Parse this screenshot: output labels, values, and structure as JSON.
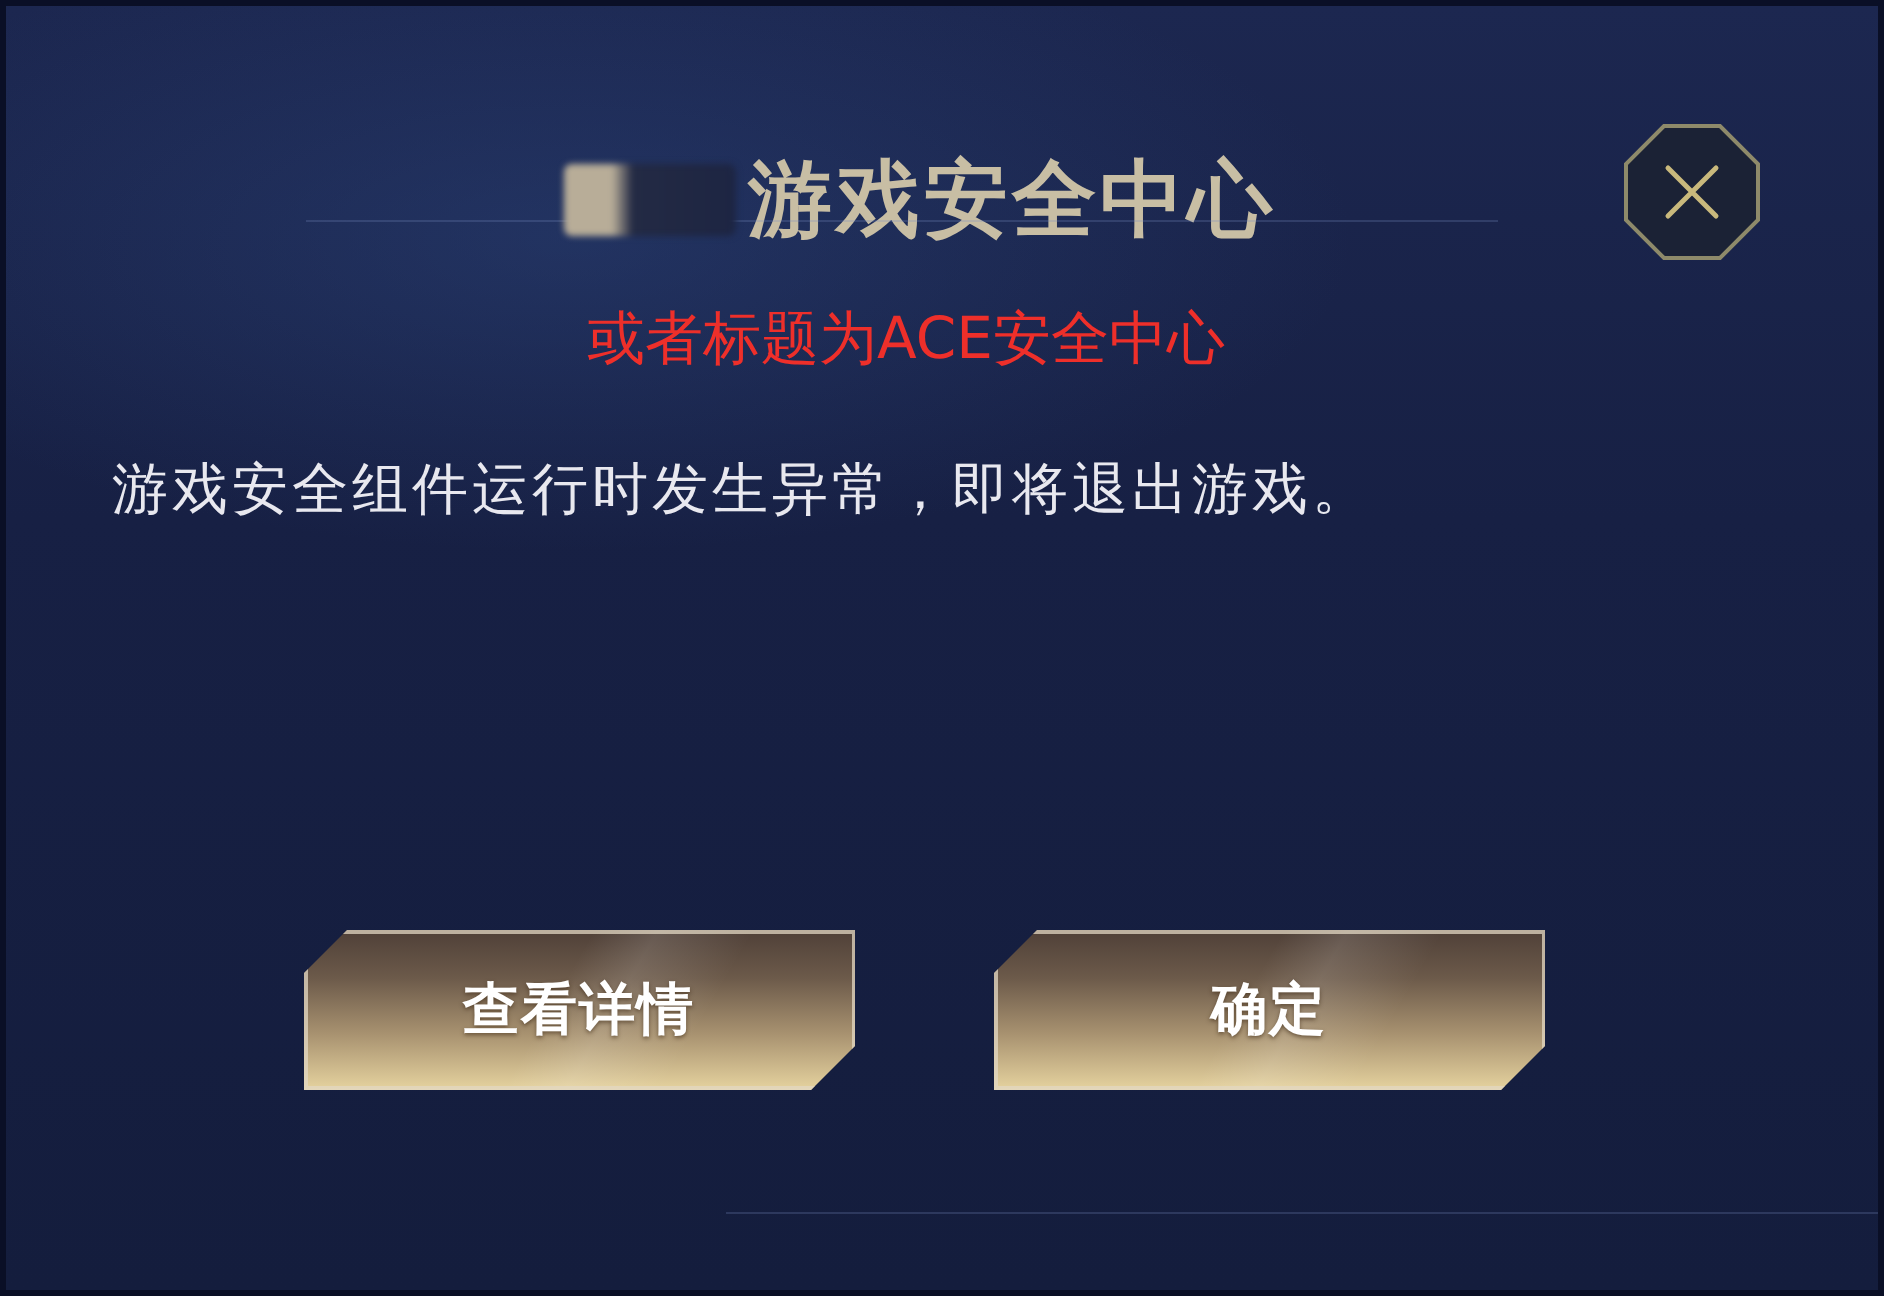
{
  "dialog": {
    "title": "游戏安全中心",
    "annotation": "或者标题为ACE安全中心",
    "message": "游戏安全组件运行时发生异常，即将退出游戏。",
    "buttons": [
      {
        "label": "查看详情"
      },
      {
        "label": "确定"
      }
    ]
  }
}
